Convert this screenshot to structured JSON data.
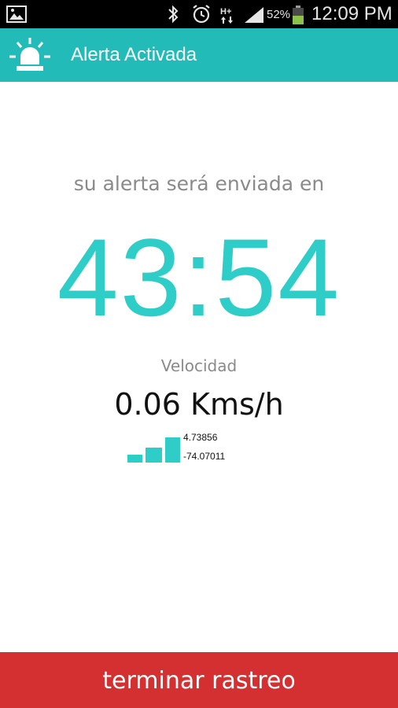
{
  "status_bar": {
    "icons": [
      "gallery-icon",
      "bluetooth-icon",
      "alarm-icon",
      "hplus-data-icon",
      "signal-icon",
      "battery-icon"
    ],
    "battery_percent": "52%",
    "time": "12:09 PM"
  },
  "action_bar": {
    "icon": "siren-icon",
    "title": "Alerta Activada",
    "color": "#22bbb8"
  },
  "main": {
    "subtitle": "su alerta será enviada en",
    "countdown": "43:54",
    "countdown_color": "#2fcdc7",
    "speed_label": "Velocidad",
    "speed_value": "0.06 Kms/h",
    "gps_signal_icon": "signal-strength-icon",
    "latitude": "4.73856",
    "longitude": "-74.07011"
  },
  "footer": {
    "stop_button_label": "terminar rastreo",
    "stop_button_color": "#d53031"
  }
}
